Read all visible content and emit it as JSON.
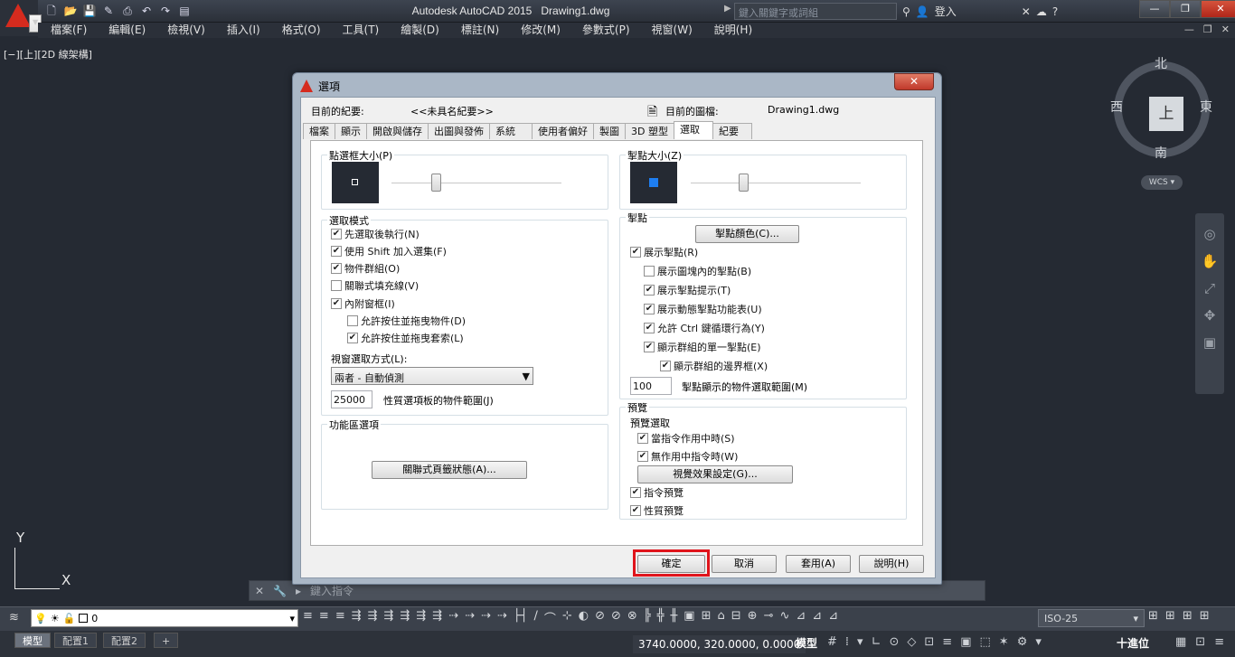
{
  "titlebar": {
    "app_title": "Autodesk AutoCAD 2015",
    "doc_title": "Drawing1.dwg",
    "search_placeholder": "鍵入關鍵字或詞組",
    "sign_in": "登入"
  },
  "menu": [
    "檔案(F)",
    "編輯(E)",
    "檢視(V)",
    "插入(I)",
    "格式(O)",
    "工具(T)",
    "繪製(D)",
    "標註(N)",
    "修改(M)",
    "參數式(P)",
    "視窗(W)",
    "說明(H)"
  ],
  "viewport": {
    "label": "[−][上][2D 線架構]"
  },
  "viewcube": {
    "top": "上",
    "north": "北",
    "south": "南",
    "east": "東",
    "west": "西",
    "wcs": "WCS"
  },
  "ucs": {
    "x": "X",
    "y": "Y"
  },
  "cmdline": {
    "placeholder": "鍵入指令"
  },
  "layer": {
    "name": "0"
  },
  "annotation_scale": "ISO-25",
  "layout_tabs": [
    "模型",
    "配置1",
    "配置2",
    "+"
  ],
  "status": {
    "coords": "3740.0000, 320.0000, 0.0000",
    "space": "模型",
    "units": "十進位"
  },
  "dialog": {
    "title": "選項",
    "current_profile_label": "目前的紀要:",
    "current_profile": "<<未具名紀要>>",
    "current_drawing_label": "目前的圖檔:",
    "current_drawing": "Drawing1.dwg",
    "tabs": [
      "檔案",
      "顯示",
      "開啟與儲存",
      "出圖與發佈",
      "系統",
      "使用者偏好",
      "製圖",
      "3D 塑型",
      "選取",
      "紀要"
    ],
    "active_tab": "選取",
    "pickbox": {
      "title": "點選框大小(P)",
      "level": 0.25
    },
    "selection_modes": {
      "title": "選取模式",
      "items": [
        {
          "label": "先選取後執行(N)",
          "checked": true
        },
        {
          "label": "使用 Shift 加入選集(F)",
          "checked": true
        },
        {
          "label": "物件群組(O)",
          "checked": true
        },
        {
          "label": "關聯式填充線(V)",
          "checked": false
        },
        {
          "label": "內附窗框(I)",
          "checked": true
        },
        {
          "label": "允許按住並拖曳物件(D)",
          "checked": false
        },
        {
          "label": "允許按住並拖曳套索(L)",
          "checked": true
        }
      ],
      "window_method_label": "視窗選取方式(L):",
      "window_method": "兩者 - 自動偵測",
      "limit_value": "25000",
      "limit_label": "性質選項板的物件範圍(J)"
    },
    "ribbon": {
      "title": "功能區選項",
      "button": "關聯式頁籤狀態(A)..."
    },
    "grip_size": {
      "title": "掣點大小(Z)",
      "level": 0.3
    },
    "grips": {
      "title": "掣點",
      "color_button": "掣點顏色(C)...",
      "items": [
        {
          "label": "展示掣點(R)",
          "checked": true
        },
        {
          "label": "展示圖塊內的掣點(B)",
          "checked": false
        },
        {
          "label": "展示掣點提示(T)",
          "checked": true
        },
        {
          "label": "展示動態掣點功能表(U)",
          "checked": true
        },
        {
          "label": "允許 Ctrl 鍵循環行為(Y)",
          "checked": true
        },
        {
          "label": "顯示群組的單一掣點(E)",
          "checked": true
        },
        {
          "label": "顯示群組的邊界框(X)",
          "checked": true
        }
      ],
      "limit_value": "100",
      "limit_label": "掣點顯示的物件選取範圍(M)"
    },
    "preview": {
      "title": "預覽",
      "subtitle": "預覽選取",
      "items": [
        {
          "label": "當指令作用中時(S)",
          "checked": true
        },
        {
          "label": "無作用中指令時(W)",
          "checked": true
        }
      ],
      "effects_button": "視覺效果設定(G)...",
      "items2": [
        {
          "label": "指令預覽",
          "checked": true
        },
        {
          "label": "性質預覽",
          "checked": true
        }
      ]
    },
    "buttons": {
      "ok": "確定",
      "cancel": "取消",
      "apply": "套用(A)",
      "help": "說明(H)"
    }
  }
}
